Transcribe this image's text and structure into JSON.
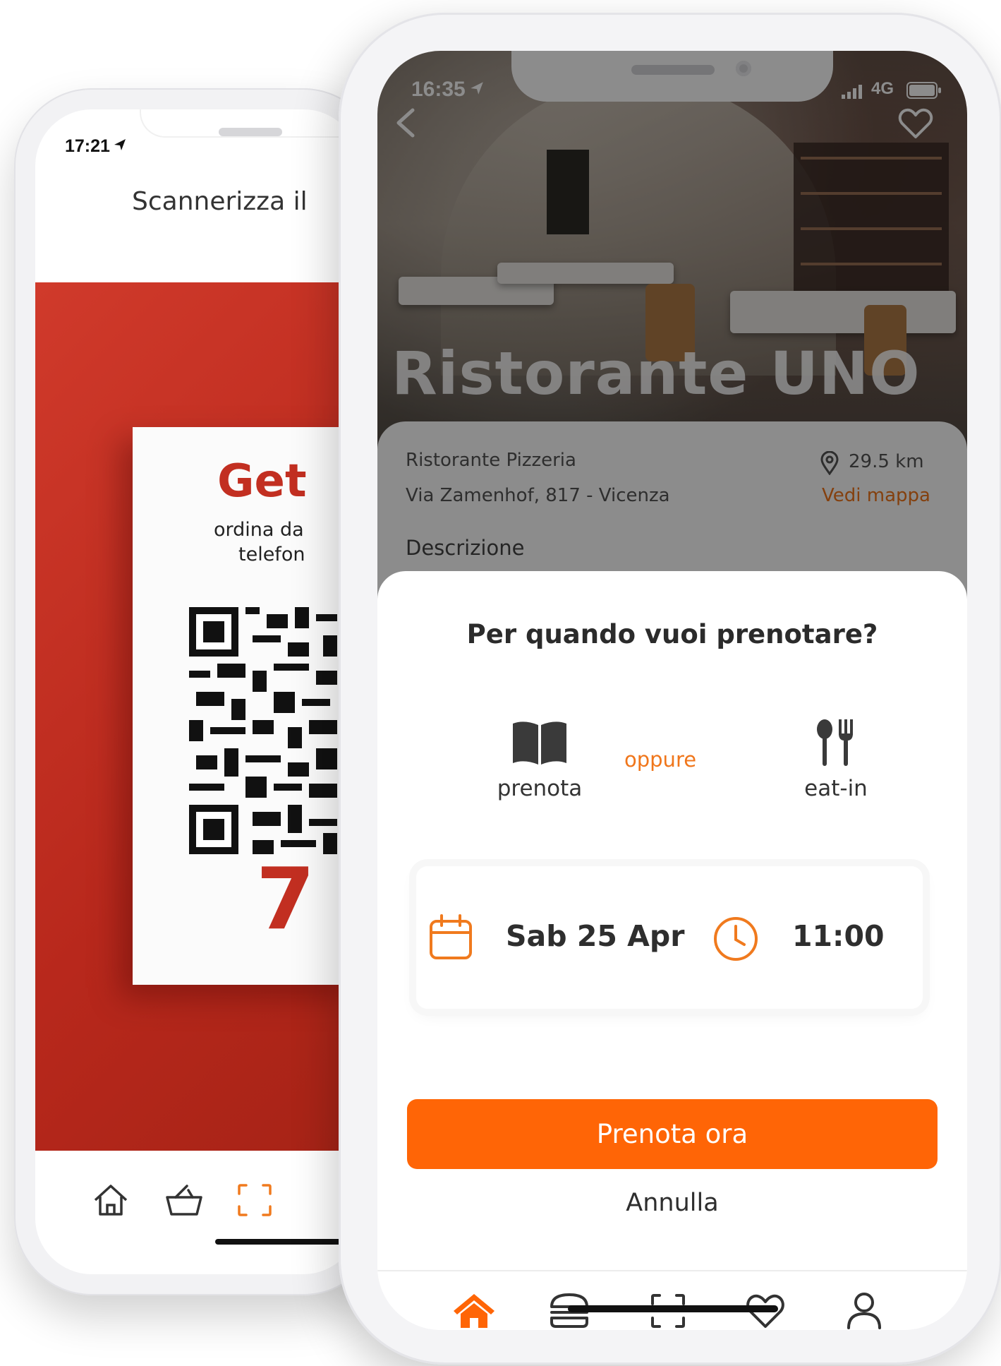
{
  "back_phone": {
    "time": "17:21",
    "header_title": "Scannerizza il",
    "card": {
      "headline": "Get",
      "line1": "ordina da",
      "line2": "telefon",
      "number": "7"
    }
  },
  "front_phone": {
    "status": {
      "time": "16:35",
      "network": "4G"
    },
    "restaurant": {
      "name": "Ristorante UNO",
      "category": "Ristorante Pizzeria",
      "address": "Via Zamenhof, 817 - Vicenza",
      "distance": "29.5 km",
      "map_link": "Vedi mappa",
      "description_heading": "Descrizione"
    },
    "sheet": {
      "title": "Per quando vuoi prenotare?",
      "option_book": "prenota",
      "option_or": "oppure",
      "option_eatin": "eat-in",
      "date": "Sab 25 Apr",
      "time": "11:00",
      "cta": "Prenota ora",
      "cancel": "Annulla"
    },
    "tabbar": [
      "home-icon",
      "burger-icon",
      "scan-icon",
      "heart-icon",
      "user-icon"
    ]
  },
  "colors": {
    "accent": "#ff6506",
    "accent_text": "#f0761b",
    "brand_red": "#c22f21"
  }
}
